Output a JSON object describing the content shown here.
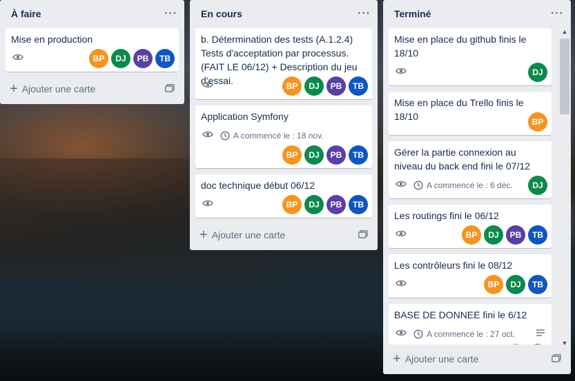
{
  "members": {
    "BP": {
      "initials": "BP",
      "color": "#f7941d"
    },
    "DJ": {
      "initials": "DJ",
      "color": "#0b8a4d"
    },
    "PB": {
      "initials": "PB",
      "color": "#5a3fa8"
    },
    "TB": {
      "initials": "TB",
      "color": "#0f56c4"
    }
  },
  "icons": {
    "list_menu": "more-horizontal-icon",
    "watch": "eye-icon",
    "clock": "clock-icon",
    "description": "description-icon",
    "add": "plus-icon",
    "template": "card-template-icon"
  },
  "lists": [
    {
      "title": "À faire",
      "add_card_label": "Ajouter une carte",
      "cards": [
        {
          "title": "Mise en production",
          "members": [
            "BP",
            "DJ",
            "PB",
            "TB"
          ]
        }
      ]
    },
    {
      "title": "En cours",
      "add_card_label": "Ajouter une carte",
      "cards": [
        {
          "title": "b. Détermination des tests (A.1.2.4) Tests d'acceptation par processus. (FAIT LE 06/12) + Description du jeu d'essai.",
          "members": [
            "BP",
            "DJ",
            "PB",
            "TB"
          ]
        },
        {
          "title": "Application Symfony",
          "start_date": "A commencé le : 18 nov.",
          "members": [
            "BP",
            "DJ",
            "PB",
            "TB"
          ]
        },
        {
          "title": "doc technique début 06/12",
          "members": [
            "BP",
            "DJ",
            "PB",
            "TB"
          ]
        }
      ]
    },
    {
      "title": "Terminé",
      "add_card_label": "Ajouter une carte",
      "cards": [
        {
          "title": "Mise en place du github finis le 18/10",
          "members": [
            "DJ"
          ]
        },
        {
          "title": "Mise en place du Trello finis le 18/10",
          "members": [
            "BP"
          ]
        },
        {
          "title": "Gérer la partie connexion au niveau du back end fini le 07/12",
          "start_date": "A commencé le : 6 déc.",
          "members": [
            "DJ"
          ]
        },
        {
          "title": "Les routings fini le 06/12",
          "members": [
            "BP",
            "DJ",
            "PB",
            "TB"
          ]
        },
        {
          "title": "Les contrôleurs fini le 08/12",
          "members": [
            "BP",
            "DJ",
            "TB"
          ]
        },
        {
          "title": "BASE DE DONNEE fini le 6/12",
          "start_date": "A commencé le : 27 oct.",
          "members": [
            "BP",
            "DJ"
          ]
        }
      ]
    }
  ]
}
